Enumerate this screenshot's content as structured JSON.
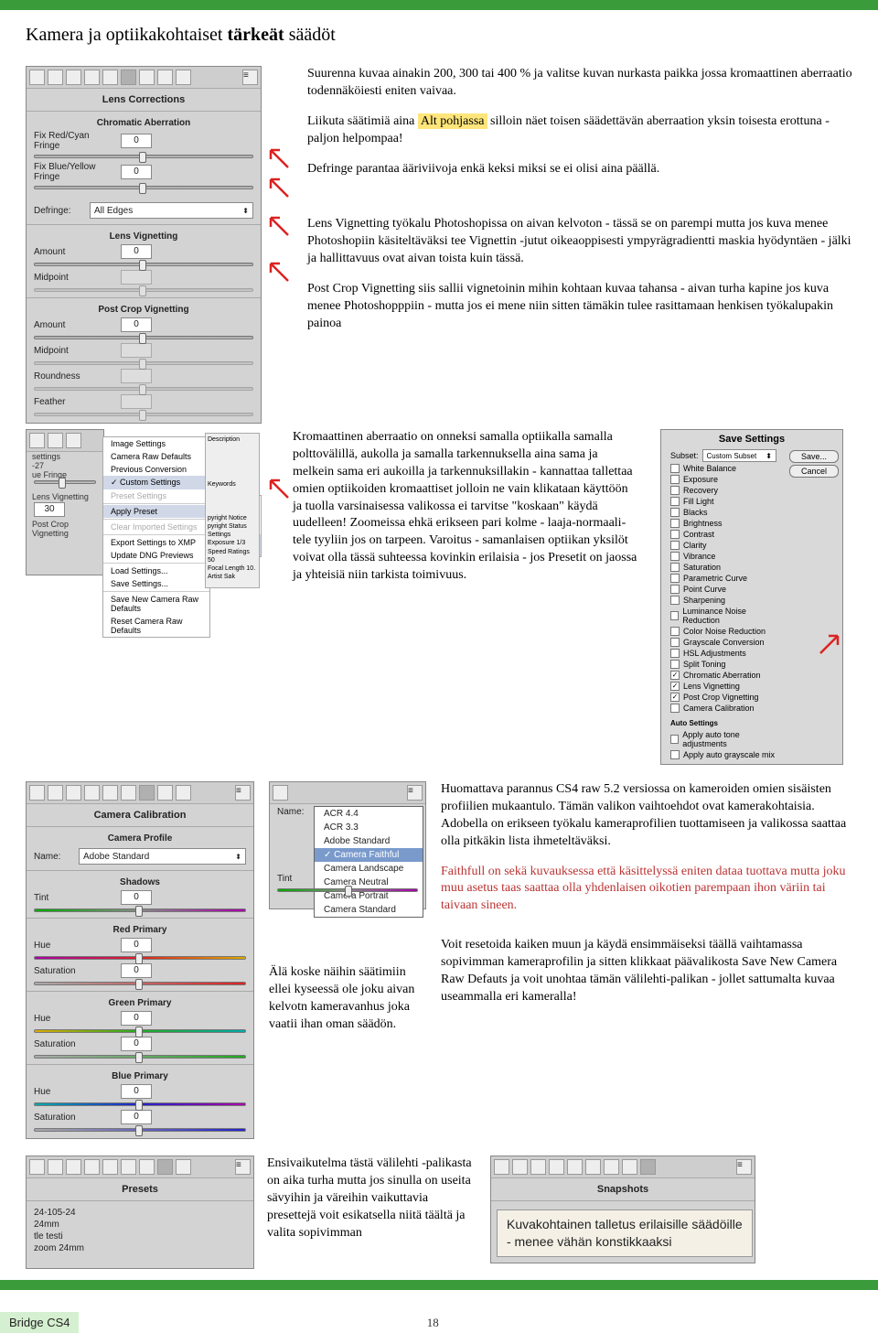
{
  "title_plain": "Kamera ja optiikakohtaiset ",
  "title_bold": "tärkeät",
  "title_tail": " säädöt",
  "lens_panel": {
    "section1": "Lens Corrections",
    "sub_chrom": "Chromatic Aberration",
    "fix_rc": "Fix Red/Cyan Fringe",
    "fix_rc_val": "0",
    "fix_by": "Fix Blue/Yellow Fringe",
    "fix_by_val": "0",
    "defringe_lbl": "Defringe:",
    "defringe_val": "All Edges",
    "sub_vig": "Lens Vignetting",
    "amount": "Amount",
    "amount_val": "0",
    "midpoint": "Midpoint",
    "sub_postvig": "Post Crop Vignetting",
    "amount2_val": "0",
    "roundness": "Roundness",
    "feather": "Feather"
  },
  "para1": "Suurenna kuvaa ainakin 200, 300 tai 400 % ja valitse kuvan nurkasta paikka jossa kromaattinen aberraatio todennäköiesti eniten vaivaa.",
  "para2_pre": "Liikuta säätimiä aina ",
  "para2_hl": "Alt pohjassa",
  "para2_post": " silloin näet toisen säädettävän aberraation yksin toisesta erottuna - paljon helpompaa!",
  "para3": "Defringe parantaa ääriviivoja enkä keksi miksi se ei olisi aina päällä.",
  "para4": "Lens Vignetting työkalu Photoshopissa on aivan kelvoton - tässä se on parempi mutta jos kuva menee Photoshopiin käsiteltäväksi tee Vignettin -jutut oikeaoppisesti ympyrägradientti maskia hyödyntäen - jälki ja hallittavuus ovat aivan toista kuin tässä.",
  "para5": "Post Crop Vignetting siis sallii vignetoinin mihin kohtaan kuvaa tahansa - aivan turha kapine jos kuva menee Photoshopppiin - mutta jos ei mene niin sitten tämäkin tulee rasittamaan henkisen työkalupakin painoa",
  "save_settings": {
    "title": "Save Settings",
    "subset_lbl": "Subset:",
    "subset_val": "Custom Subset",
    "save": "Save...",
    "cancel": "Cancel",
    "checks": [
      "White Balance",
      "Exposure",
      "Recovery",
      "Fill Light",
      "Blacks",
      "Brightness",
      "Contrast",
      "Clarity",
      "Vibrance",
      "Saturation",
      "Parametric Curve",
      "Point Curve",
      "Sharpening",
      "Luminance Noise Reduction",
      "Color Noise Reduction",
      "Grayscale Conversion",
      "HSL Adjustments",
      "Split Toning",
      "Chromatic Aberration",
      "Lens Vignetting",
      "Post Crop Vignetting",
      "Camera Calibration"
    ],
    "auto_settings": "Auto Settings",
    "auto1": "Apply auto tone adjustments",
    "auto2": "Apply auto grayscale mix"
  },
  "context_menu": {
    "items_top": [
      "Image Settings",
      "Camera Raw Defaults",
      "Previous Conversion"
    ],
    "custom": "Custom Settings",
    "preset_settings": "Preset Settings",
    "apply_preset": "Apply Preset",
    "sub_presets": [
      "24-105-24",
      "24mm",
      "tle testi",
      "zoom 24mm"
    ],
    "clear": "Clear Imported Settings",
    "export_xmp": "Export Settings to XMP",
    "update_dng": "Update DNG Previews",
    "load": "Load Settings...",
    "save": "Save Settings...",
    "save_new": "Save New Camera Raw Defaults",
    "reset": "Reset Camera Raw Defaults"
  },
  "keywords_panel": {
    "desc": "Description",
    "keywords": "Keywords",
    "pyright": "pyright Notice",
    "pyright_status": "pyright Status",
    "settings": "Settings",
    "exposure": "Exposure 1/3",
    "speed": "Speed Ratings 50",
    "focal": "Focal Length 10.",
    "artist": "Artist Sak"
  },
  "para6": "Kromaattinen aberraatio on onneksi samalla optiikalla samalla polttovälillä, aukolla ja samalla tarkennuksella aina sama ja melkein sama eri aukoilla ja tarkennuksillakin - kannattaa tallettaa omien optiikoiden kromaattiset jolloin ne vain klikataan käyttöön ja tuolla varsinaisessa valikossa ei tarvitse \"koskaan\" käydä uudelleen! Zoomeissa ehkä erikseen pari kolme - laaja-normaali-tele tyyliin jos on tarpeen. Varoitus - samanlaisen optiikan yksilöt voivat olla tässä suhteessa kovinkin erilaisia - jos Presetit on jaossa ja yhteisiä niin tarkista toimivuus.",
  "calib_panel": {
    "title": "Camera Calibration",
    "profile_lbl": "Camera Profile",
    "name_lbl": "Name:",
    "name_val": "Adobe Standard",
    "shadows": "Shadows",
    "tint": "Tint",
    "red_primary": "Red Primary",
    "hue": "Hue",
    "hue_val": "0",
    "saturation": "Saturation",
    "sat_val": "0",
    "green_primary": "Green Primary",
    "blue_primary": "Blue Primary"
  },
  "profile_dropdown": {
    "name_lbl": "Name:",
    "tint": "Tint",
    "options": [
      "ACR 4.4",
      "ACR 3.3",
      "Adobe Standard",
      "Camera Faithful",
      "Camera Landscape",
      "Camera Neutral",
      "Camera Portrait",
      "Camera Standard"
    ],
    "selected": "Camera Faithful"
  },
  "para7": "Huomattava parannus CS4 raw 5.2 versiossa on kameroiden omien sisäisten profiilien mukaantulo. Tämän valikon vaihtoehdot ovat kamerakohtaisia. Adobella on erikseen työkalu kameraprofilien tuottamiseen ja valikossa saattaa olla pitkäkin lista ihmeteltäväksi.",
  "para8_bold": "Faithfull",
  "para8": " on sekä kuvauksessa että käsittelyssä eniten dataa tuottava mutta joku muu asetus taas saattaa olla yhdenlaisen oikotien parempaan ihon väriin tai taivaan sineen.",
  "para9": "Älä koske näihin säätimiin ellei kyseessä ole joku aivan kelvotn kameravanhus joka vaatii ihan oman säädön.",
  "para10": "Voit resetoida kaiken muun ja käydä ensimmäiseksi täällä vaihtamassa sopivimman kameraprofilin ja sitten klikkaat päävalikosta Save New Camera Raw Defauts ja voit unohtaa tämän välilehti-palikan - jollet sattumalta kuvaa useammalla eri kameralla!",
  "presets_panel": {
    "title": "Presets",
    "items": [
      "24-105-24",
      "24mm",
      "tle testi",
      "zoom 24mm"
    ]
  },
  "para11": "Ensivaikutelma tästä välilehti -palikasta on aika turha mutta jos sinulla on useita sävyihin ja väreihin vaikuttavia presettejä voit esikatsella niitä täältä ja valita sopivimman",
  "snapshots": {
    "title": "Snapshots",
    "text": "Kuvakohtainen talletus erilaisille säädöille - menee vähän konstikkaaksi"
  },
  "footer_label": "Bridge CS4",
  "footer_page": "18",
  "mini_settings": "-27",
  "mini_amount": "30",
  "mini_lens_vig": "Lens Vignetting",
  "mini_post_crop": "Post Crop Vignetting"
}
